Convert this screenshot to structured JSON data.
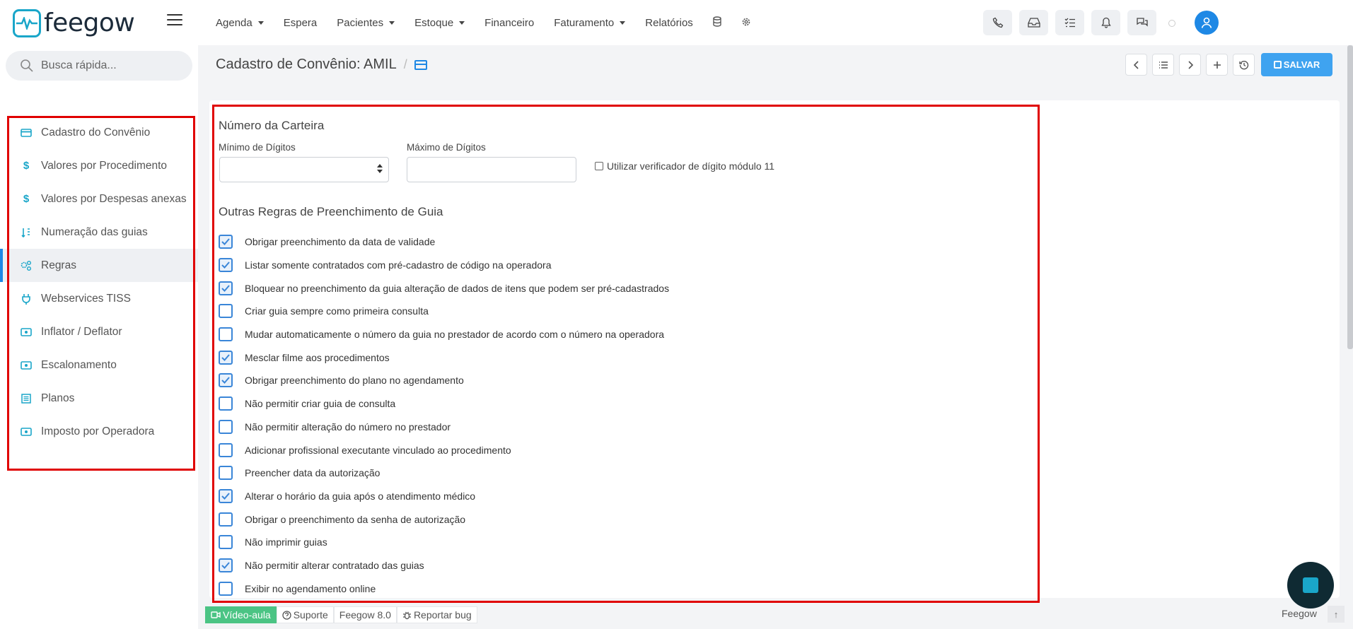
{
  "app": {
    "logo_text": "feegow",
    "brand_color": "#1aa6c9",
    "accent_color": "#1e88e5"
  },
  "nav": [
    {
      "label": "Agenda",
      "dropdown": true
    },
    {
      "label": "Espera",
      "dropdown": false
    },
    {
      "label": "Pacientes",
      "dropdown": true
    },
    {
      "label": "Estoque",
      "dropdown": true
    },
    {
      "label": "Financeiro",
      "dropdown": false
    },
    {
      "label": "Faturamento",
      "dropdown": true
    },
    {
      "label": "Relatórios",
      "dropdown": false
    }
  ],
  "search": {
    "placeholder": "Busca rápida..."
  },
  "sidebar": {
    "items": [
      {
        "label": "Cadastro do Convênio",
        "icon": "card-icon"
      },
      {
        "label": "Valores por Procedimento",
        "icon": "dollar-icon"
      },
      {
        "label": "Valores por Despesas anexas",
        "icon": "dollar-icon"
      },
      {
        "label": "Numeração das guias",
        "icon": "sort-icon"
      },
      {
        "label": "Regras",
        "icon": "cogs-icon",
        "active": true
      },
      {
        "label": "Webservices TISS",
        "icon": "plug-icon"
      },
      {
        "label": "Inflator / Deflator",
        "icon": "money-icon"
      },
      {
        "label": "Escalonamento",
        "icon": "money-icon"
      },
      {
        "label": "Planos",
        "icon": "list-icon"
      },
      {
        "label": "Imposto por Operadora",
        "icon": "money-icon"
      }
    ]
  },
  "page": {
    "title": "Cadastro de Convênio: AMIL",
    "separator": "/",
    "save_label": "SALVAR"
  },
  "carteira": {
    "title": "Número da Carteira",
    "min_label": "Mínimo de Dígitos",
    "max_label": "Máximo de Dígitos",
    "min_value": "",
    "max_value": "",
    "mod11_label": "Utilizar verificador de dígito módulo 11",
    "mod11_checked": false
  },
  "rules": {
    "title": "Outras Regras de Preenchimento de Guia",
    "items": [
      {
        "label": "Obrigar preenchimento da data de validade",
        "checked": true
      },
      {
        "label": "Listar somente contratados com pré-cadastro de código na operadora",
        "checked": true
      },
      {
        "label": "Bloquear no preenchimento da guia alteração de dados de itens que podem ser pré-cadastrados",
        "checked": true
      },
      {
        "label": "Criar guia sempre como primeira consulta",
        "checked": false
      },
      {
        "label": "Mudar automaticamente o número da guia no prestador de acordo com o número na operadora",
        "checked": false
      },
      {
        "label": "Mesclar filme aos procedimentos",
        "checked": true
      },
      {
        "label": "Obrigar preenchimento do plano no agendamento",
        "checked": true
      },
      {
        "label": "Não permitir criar guia de consulta",
        "checked": false
      },
      {
        "label": "Não permitir alteração do número no prestador",
        "checked": false
      },
      {
        "label": "Adicionar profissional executante vinculado ao procedimento",
        "checked": false
      },
      {
        "label": "Preencher data da autorização",
        "checked": false
      },
      {
        "label": "Alterar o horário da guia após o atendimento médico",
        "checked": true
      },
      {
        "label": "Obrigar o preenchimento da senha de autorização",
        "checked": false
      },
      {
        "label": "Não imprimir guias",
        "checked": false
      },
      {
        "label": "Não permitir alterar contratado das guias",
        "checked": true
      },
      {
        "label": "Exibir no agendamento online",
        "checked": false
      }
    ]
  },
  "footer": {
    "video": "Vídeo-aula",
    "support": "Suporte",
    "version": "Feegow 8.0",
    "bug": "Reportar bug",
    "brand": "Feegow",
    "video_color": "#4bc484"
  },
  "annotation_color": "#e00000"
}
